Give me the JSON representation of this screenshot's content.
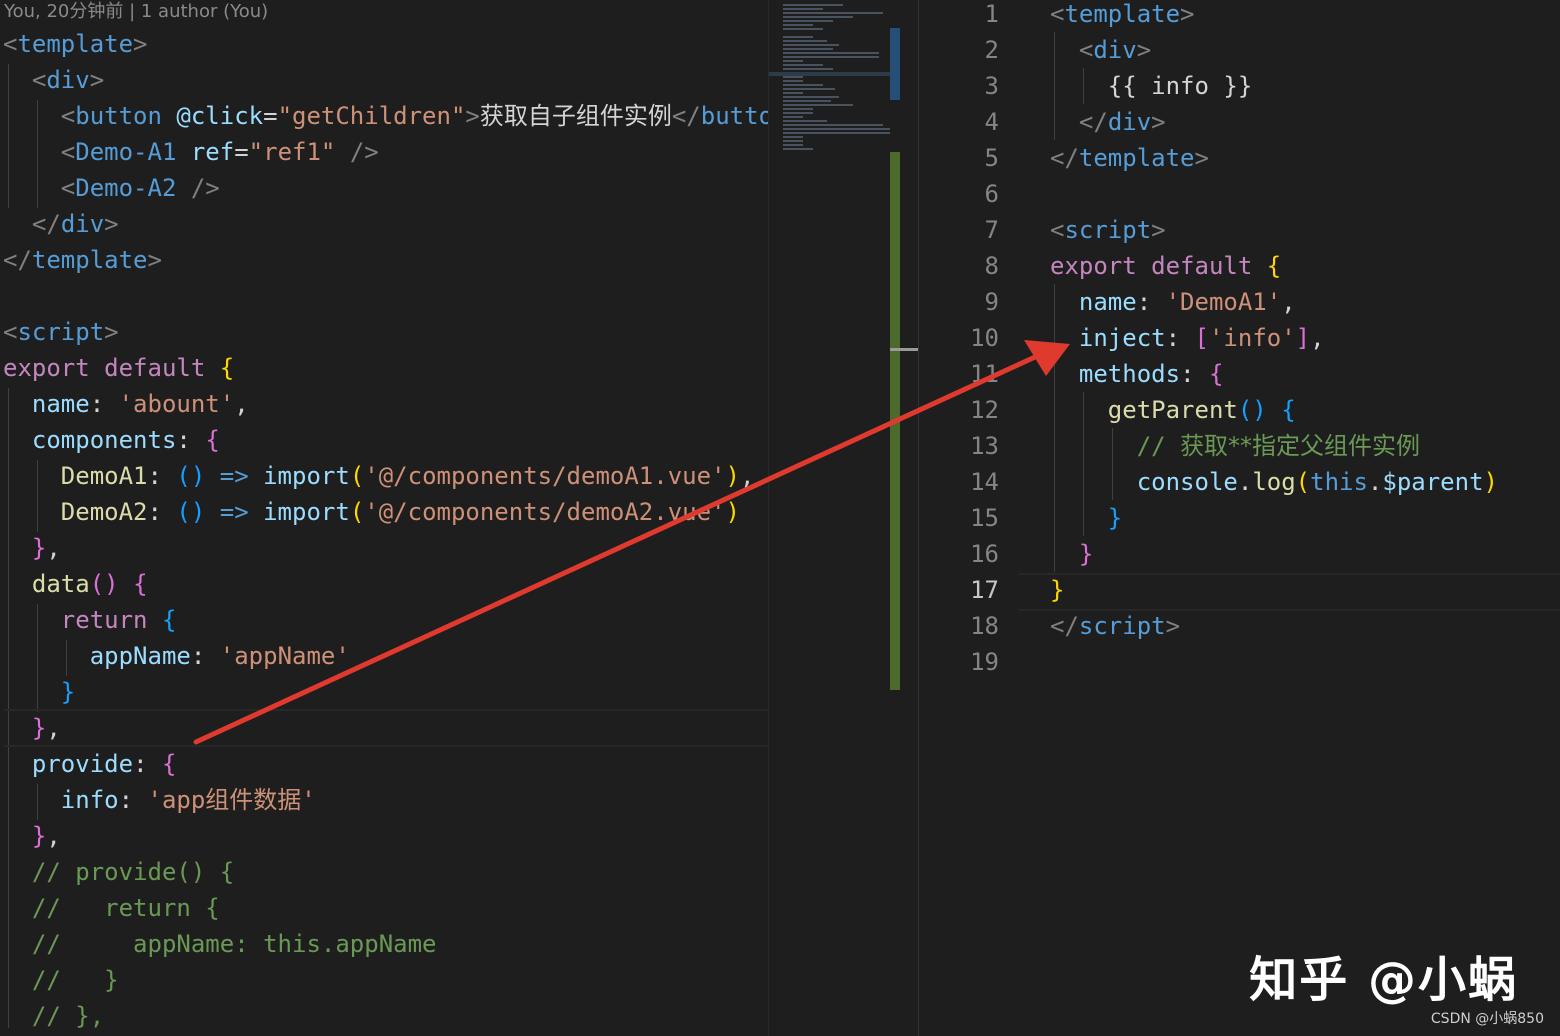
{
  "left_editor": {
    "blame": "You, 20分钟前 | 1 author (You)",
    "lines": [
      [
        [
          "<",
          "t-punct"
        ],
        [
          "template",
          "t-tag"
        ],
        [
          ">",
          "t-punct"
        ]
      ],
      [
        [
          "  ",
          "t-plain"
        ],
        [
          "<",
          "t-punct"
        ],
        [
          "div",
          "t-tag"
        ],
        [
          ">",
          "t-punct"
        ]
      ],
      [
        [
          "    ",
          "t-plain"
        ],
        [
          "<",
          "t-punct"
        ],
        [
          "button",
          "t-tag"
        ],
        [
          " ",
          "t-plain"
        ],
        [
          "@click",
          "t-attr"
        ],
        [
          "=",
          "t-plain"
        ],
        [
          "\"getChildren\"",
          "t-str"
        ],
        [
          ">",
          "t-punct"
        ],
        [
          "获取自子组件实例",
          "t-cjk"
        ],
        [
          "</",
          "t-punct"
        ],
        [
          "button",
          "t-tag"
        ]
      ],
      [
        [
          "    ",
          "t-plain"
        ],
        [
          "<",
          "t-punct"
        ],
        [
          "Demo-A1",
          "t-tag"
        ],
        [
          " ",
          "t-plain"
        ],
        [
          "ref",
          "t-attr"
        ],
        [
          "=",
          "t-plain"
        ],
        [
          "\"ref1\"",
          "t-str"
        ],
        [
          " />",
          "t-punct"
        ]
      ],
      [
        [
          "    ",
          "t-plain"
        ],
        [
          "<",
          "t-punct"
        ],
        [
          "Demo-A2",
          "t-tag"
        ],
        [
          " />",
          "t-punct"
        ]
      ],
      [
        [
          "  ",
          "t-plain"
        ],
        [
          "</",
          "t-punct"
        ],
        [
          "div",
          "t-tag"
        ],
        [
          ">",
          "t-punct"
        ]
      ],
      [
        [
          "</",
          "t-punct"
        ],
        [
          "template",
          "t-tag"
        ],
        [
          ">",
          "t-punct"
        ]
      ],
      [],
      [
        [
          "<",
          "t-punct"
        ],
        [
          "script",
          "t-tag"
        ],
        [
          ">",
          "t-punct"
        ]
      ],
      [
        [
          "export",
          "t-kw"
        ],
        [
          " ",
          "t-plain"
        ],
        [
          "default",
          "t-kw"
        ],
        [
          " ",
          "t-plain"
        ],
        [
          "{",
          "t-b1"
        ]
      ],
      [
        [
          "  ",
          "t-plain"
        ],
        [
          "name",
          "t-var"
        ],
        [
          ": ",
          "t-plain"
        ],
        [
          "'abount'",
          "t-str"
        ],
        [
          ",",
          "t-plain"
        ]
      ],
      [
        [
          "  ",
          "t-plain"
        ],
        [
          "components",
          "t-var"
        ],
        [
          ": ",
          "t-plain"
        ],
        [
          "{",
          "t-b2"
        ]
      ],
      [
        [
          "    ",
          "t-plain"
        ],
        [
          "DemoA1",
          "t-fn"
        ],
        [
          ": ",
          "t-plain"
        ],
        [
          "()",
          "t-b3"
        ],
        [
          " => ",
          "t-this"
        ],
        [
          "import",
          "t-var"
        ],
        [
          "(",
          "t-b1"
        ],
        [
          "'@/components/demoA1.vue'",
          "t-str"
        ],
        [
          ")",
          "t-b1"
        ],
        [
          ",",
          "t-plain"
        ]
      ],
      [
        [
          "    ",
          "t-plain"
        ],
        [
          "DemoA2",
          "t-fn"
        ],
        [
          ": ",
          "t-plain"
        ],
        [
          "()",
          "t-b3"
        ],
        [
          " => ",
          "t-this"
        ],
        [
          "import",
          "t-var"
        ],
        [
          "(",
          "t-b1"
        ],
        [
          "'@/components/demoA2.vue'",
          "t-str"
        ],
        [
          ")",
          "t-b1"
        ]
      ],
      [
        [
          "  ",
          "t-plain"
        ],
        [
          "}",
          "t-b2"
        ],
        [
          ",",
          "t-plain"
        ]
      ],
      [
        [
          "  ",
          "t-plain"
        ],
        [
          "data",
          "t-fn"
        ],
        [
          "()",
          "t-b2"
        ],
        [
          " ",
          "t-plain"
        ],
        [
          "{",
          "t-b2"
        ]
      ],
      [
        [
          "    ",
          "t-plain"
        ],
        [
          "return",
          "t-kw"
        ],
        [
          " ",
          "t-plain"
        ],
        [
          "{",
          "t-b3"
        ]
      ],
      [
        [
          "      ",
          "t-plain"
        ],
        [
          "appName",
          "t-var"
        ],
        [
          ": ",
          "t-plain"
        ],
        [
          "'appName'",
          "t-str"
        ]
      ],
      [
        [
          "    ",
          "t-plain"
        ],
        [
          "}",
          "t-b3"
        ]
      ],
      [
        [
          "  ",
          "t-plain"
        ],
        [
          "}",
          "t-b2"
        ],
        [
          ",",
          "t-plain"
        ]
      ],
      [
        [
          "  ",
          "t-plain"
        ],
        [
          "provide",
          "t-var"
        ],
        [
          ": ",
          "t-plain"
        ],
        [
          "{",
          "t-b2"
        ]
      ],
      [
        [
          "    ",
          "t-plain"
        ],
        [
          "info",
          "t-var"
        ],
        [
          ": ",
          "t-plain"
        ],
        [
          "'app组件数据'",
          "t-str"
        ]
      ],
      [
        [
          "  ",
          "t-plain"
        ],
        [
          "}",
          "t-b2"
        ],
        [
          ",",
          "t-plain"
        ]
      ],
      [
        [
          "  ",
          "t-plain"
        ],
        [
          "// provide() {",
          "t-cmt"
        ]
      ],
      [
        [
          "  ",
          "t-plain"
        ],
        [
          "//   return {",
          "t-cmt"
        ]
      ],
      [
        [
          "  ",
          "t-plain"
        ],
        [
          "//     appName: this.appName",
          "t-cmt"
        ]
      ],
      [
        [
          "  ",
          "t-plain"
        ],
        [
          "//   }",
          "t-cmt"
        ]
      ],
      [
        [
          "  ",
          "t-plain"
        ],
        [
          "// },",
          "t-cmt"
        ]
      ]
    ]
  },
  "right_editor": {
    "line_numbers": [
      "1",
      "2",
      "3",
      "4",
      "5",
      "6",
      "7",
      "8",
      "9",
      "10",
      "11",
      "12",
      "13",
      "14",
      "15",
      "16",
      "17",
      "18",
      "19"
    ],
    "active_line": "17",
    "lines": [
      [
        [
          "<",
          "t-punct"
        ],
        [
          "template",
          "t-tag"
        ],
        [
          ">",
          "t-punct"
        ]
      ],
      [
        [
          "  ",
          "t-plain"
        ],
        [
          "<",
          "t-punct"
        ],
        [
          "div",
          "t-tag"
        ],
        [
          ">",
          "t-punct"
        ]
      ],
      [
        [
          "    ",
          "t-plain"
        ],
        [
          "{{ info }}",
          "t-plain"
        ]
      ],
      [
        [
          "  ",
          "t-plain"
        ],
        [
          "</",
          "t-punct"
        ],
        [
          "div",
          "t-tag"
        ],
        [
          ">",
          "t-punct"
        ]
      ],
      [
        [
          "</",
          "t-punct"
        ],
        [
          "template",
          "t-tag"
        ],
        [
          ">",
          "t-punct"
        ]
      ],
      [],
      [
        [
          "<",
          "t-punct"
        ],
        [
          "script",
          "t-tag"
        ],
        [
          ">",
          "t-punct"
        ]
      ],
      [
        [
          "export",
          "t-kw"
        ],
        [
          " ",
          "t-plain"
        ],
        [
          "default",
          "t-kw"
        ],
        [
          " ",
          "t-plain"
        ],
        [
          "{",
          "t-b1"
        ]
      ],
      [
        [
          "  ",
          "t-plain"
        ],
        [
          "name",
          "t-var"
        ],
        [
          ": ",
          "t-plain"
        ],
        [
          "'DemoA1'",
          "t-str"
        ],
        [
          ",",
          "t-plain"
        ]
      ],
      [
        [
          "  ",
          "t-plain"
        ],
        [
          "inject",
          "t-var"
        ],
        [
          ": ",
          "t-plain"
        ],
        [
          "[",
          "t-b2"
        ],
        [
          "'info'",
          "t-str"
        ],
        [
          "]",
          "t-b2"
        ],
        [
          ",",
          "t-plain"
        ]
      ],
      [
        [
          "  ",
          "t-plain"
        ],
        [
          "methods",
          "t-var"
        ],
        [
          ": ",
          "t-plain"
        ],
        [
          "{",
          "t-b2"
        ]
      ],
      [
        [
          "    ",
          "t-plain"
        ],
        [
          "getParent",
          "t-fn"
        ],
        [
          "()",
          "t-b3"
        ],
        [
          " ",
          "t-plain"
        ],
        [
          "{",
          "t-b3"
        ]
      ],
      [
        [
          "      ",
          "t-plain"
        ],
        [
          "// ",
          "t-cmt"
        ],
        [
          "获取**指定父组件实例",
          "t-cjk-cmt"
        ]
      ],
      [
        [
          "      ",
          "t-plain"
        ],
        [
          "console",
          "t-var"
        ],
        [
          ".",
          "t-plain"
        ],
        [
          "log",
          "t-fn"
        ],
        [
          "(",
          "t-b1"
        ],
        [
          "this",
          "t-this"
        ],
        [
          ".",
          "t-plain"
        ],
        [
          "$parent",
          "t-var"
        ],
        [
          ")",
          "t-b1"
        ]
      ],
      [
        [
          "    ",
          "t-plain"
        ],
        [
          "}",
          "t-b3"
        ]
      ],
      [
        [
          "  ",
          "t-plain"
        ],
        [
          "}",
          "t-b2"
        ]
      ],
      [
        [
          "}",
          "t-b1"
        ]
      ],
      [
        [
          "</",
          "t-punct"
        ],
        [
          "script",
          "t-tag"
        ],
        [
          ">",
          "t-punct"
        ]
      ],
      []
    ]
  },
  "watermark": "知乎 @小蜗",
  "watermark_small": "CSDN @小蜗850",
  "colors": {
    "background": "#1e1e1e",
    "arrow": "#e03a2e",
    "scroll_blue": "#264f78",
    "scroll_green": "#4b6a2b"
  }
}
